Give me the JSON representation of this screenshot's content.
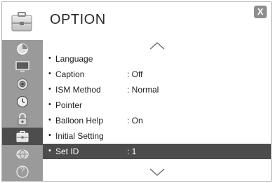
{
  "header": {
    "title": "OPTION",
    "close_label": "X",
    "icon": "option-suitcase-icon"
  },
  "sidebar": {
    "items": [
      {
        "icon": "picture-icon"
      },
      {
        "icon": "tv-icon"
      },
      {
        "icon": "speaker-icon"
      },
      {
        "icon": "clock-icon"
      },
      {
        "icon": "lock-icon"
      },
      {
        "icon": "option-icon",
        "active": true
      },
      {
        "icon": "network-icon"
      },
      {
        "icon": "help-icon",
        "label": "?"
      }
    ]
  },
  "menu": {
    "items": [
      {
        "label": "Language",
        "value": ""
      },
      {
        "label": "Caption",
        "value": ": Off"
      },
      {
        "label": "ISM Method",
        "value": ": Normal"
      },
      {
        "label": "Pointer",
        "value": ""
      },
      {
        "label": "Balloon Help",
        "value": ": On"
      },
      {
        "label": "Initial Setting",
        "value": ""
      },
      {
        "label": "Set ID",
        "value": ": 1",
        "selected": true
      }
    ],
    "bullet": "•"
  },
  "colors": {
    "sidebar_bg": "#9a9a9a",
    "active_bg": "#4d4d4d",
    "selected_row_bg": "#4c4c4c",
    "text": "#1e1e1e"
  }
}
